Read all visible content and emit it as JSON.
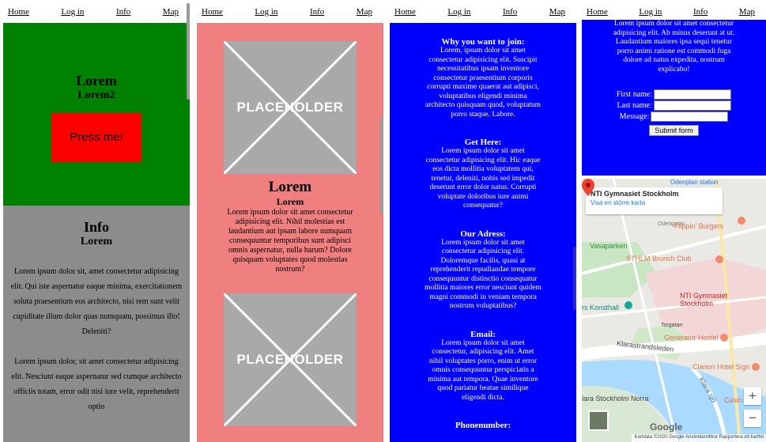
{
  "nav": {
    "home": "Home",
    "login": "Log in",
    "info": "Info",
    "map": "Map"
  },
  "panel1": {
    "hero_title": "Lorem",
    "hero_subtitle": "Lorem2",
    "press_button": "Press me!",
    "info_title": "Info",
    "info_subtitle": "Lorem",
    "paragraph1": "Lorem ipsum dolor sit, amet consectetur adipisicing elit. Qui iste aspernatur eaque minima, exercitationem soluta praesentium eos architecto, nisi rem sunt velit cupiditate illum dolor quas numquam, possimus illo! Deleniti?",
    "paragraph2": "Lorem ipsum dolor, sit amet consectetur adipisicing elit. Nesciunt eaque aspernatur sed cumque architecto officiis totam, error odit nisi iure velit, reprehenderit optio"
  },
  "panel2": {
    "placeholder_text": "PLACEHOLDER",
    "title": "Lorem",
    "subtitle": "Lorem",
    "paragraph": "Lorem ipsum dolor sit amet consectetur adipisicing elit. Nihil molestias est laudantium aut ipsam labore numquam consequuntur temporibus sunt adipisci omnis aspernatur, nulla harum? Dolore quisquam voluptates quod molestias nostrum?"
  },
  "panel3": {
    "sections": [
      {
        "heading": "Why you want to join:",
        "text": "Lorem, ipsum dolor sit amet consectetur adipisicing elit. Suscipit necessitatibus ipsam inventore consectetur praesentium corporis corrupti maxime quaerat aut adipisci, voluptatibus eligendi minima architecto quisquam quod, voluptatum porro staque. Labore."
      },
      {
        "heading": "Get Here:",
        "text": "Lorem ipsum dolor sit amet consectetur adipisicing elit. Hic eaque eos dicta mollitia voluptatem qui, tenetur, deleniti, nobis sed impedit deserunt error dolor natus. Corrupti voluptate doloribus iure animi consequatur?"
      },
      {
        "heading": "Our Adress:",
        "text": "Lorem ipsum dolor sit amet consectetur adipisicing elit. Doloremque facilis, quasi at reprehenderit repudiandae tempore consequuntur distinctio consequatur mollitia maiores error nesciunt quidem magni commodi in veniam tempora nostrum voluptatibus?"
      },
      {
        "heading": "Email:",
        "text": "Lorem ipsum dolor sit amet consectetur, adipisicing elit. Amet nihil voluptates porro, enim ut error omnis consequuntur perspiciatis a minima aut tempora. Quae inventore quod pariatur beatae similique eligendi dicta."
      },
      {
        "heading": "Phonenumber:",
        "text": ""
      }
    ]
  },
  "panel4": {
    "top_text": "Lorem ipsum dolor sit amet consectetur adipisicing elit. Ab minus deserunt at ut. Laudantium maiores ipsa sequi tenetur porro animi ratione est commodi fuga dolore ad natus expedita, nostrum explicabo!",
    "form": {
      "first_name_label": "First name:",
      "last_name_label": "Last name:",
      "message_label": "Message:",
      "submit_label": "Submit form"
    },
    "map": {
      "place_name": "NTI Gymnasiet Stockholm",
      "larger_map_link": "Visa en större karta",
      "labels": {
        "flippin": "Flippin' Burgers",
        "vasaparken": "Vasaparken",
        "sthlm_brunch": "STHLM Brunch Club",
        "konsthall": "rs Konsthall",
        "pin_label": "NTI Gymnasiet Stockholm",
        "torgatan": "Torgatan",
        "generator": "Generator Hostel",
        "klarastrand": "Klarastrandsleden",
        "clarion": "Clarion Hotel Sign",
        "klara_sjo": "Klara sjö",
        "clara_norra": "lara Stockholm Norra",
        "casino": "Casin",
        "odenplan": "Odenplan station",
        "odengatan": "Odengatan"
      },
      "zoom_in": "+",
      "zoom_out": "−",
      "google": "Google",
      "attribution": "Kartdata ©2020 Google   Användarvillkor   Rapportera ett kartfel"
    }
  }
}
